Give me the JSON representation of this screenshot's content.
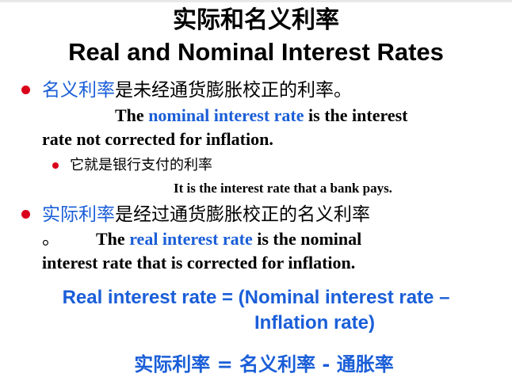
{
  "title": {
    "cn": "实际和名义利率",
    "en": "Real and Nominal Interest Rates"
  },
  "bullet_nominal": {
    "term_cn": "名义利率",
    "rest_cn": "是未经通货膨胀校正的利率。",
    "en_the": "The",
    "en_term": "nominal interest rate",
    "en_rest1": "is the interest",
    "en_rest2": "rate not corrected for inflation."
  },
  "sub_bullet": {
    "cn": "它就是银行支付的利率",
    "en": "It is the interest rate that a bank pays."
  },
  "bullet_real": {
    "term_cn": "实际利率",
    "rest_cn": "是经过通货膨胀校正的名义利率",
    "period_cn": "。",
    "en_the": "The",
    "en_term": "real interest rate",
    "en_rest1": "is the nominal",
    "en_rest2": "interest rate that is corrected for inflation."
  },
  "formula": {
    "en_line1": "Real interest rate = (Nominal interest rate –",
    "en_line2": "Inflation rate)",
    "cn": "实际利率 = 名义利率 - 通胀率"
  },
  "colors": {
    "bullet": "#d9001b",
    "accent_blue": "#1a5ed8",
    "text": "#000000"
  }
}
